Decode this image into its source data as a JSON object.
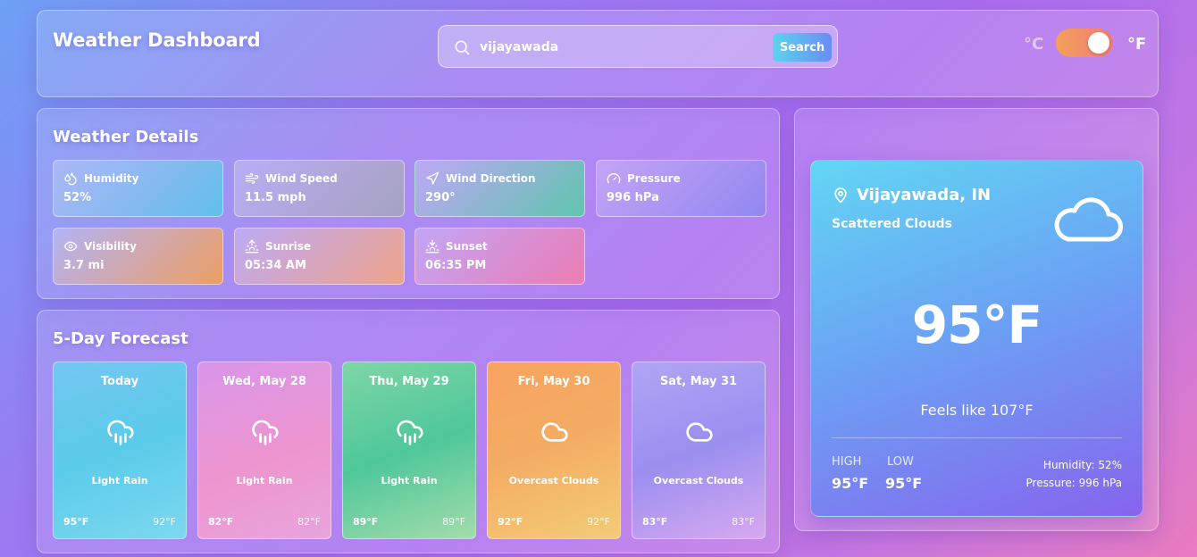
{
  "header": {
    "title": "Weather Dashboard",
    "search": {
      "value": "vijayawada",
      "button_label": "Search"
    },
    "units": {
      "celsius_label": "°C",
      "fahrenheit_label": "°F",
      "selected": "F"
    }
  },
  "details": {
    "title": "Weather Details",
    "items": [
      {
        "label": "Humidity",
        "value": "52%",
        "icon": "droplets-icon",
        "color": "#55c7e8"
      },
      {
        "label": "Wind Speed",
        "value": "11.5 mph",
        "icon": "wind-icon",
        "color": "#a3a7b7"
      },
      {
        "label": "Wind Direction",
        "value": "290°",
        "icon": "navigation-icon",
        "color": "#52cfa3"
      },
      {
        "label": "Pressure",
        "value": "996 hPa",
        "icon": "gauge-icon",
        "color": "#8c88f0"
      },
      {
        "label": "Visibility",
        "value": "3.7 mi",
        "icon": "eye-icon",
        "color": "#f5a24c"
      },
      {
        "label": "Sunrise",
        "value": "05:34 AM",
        "icon": "sunrise-icon",
        "color": "#f7a87a"
      },
      {
        "label": "Sunset",
        "value": "06:35 PM",
        "icon": "sunset-icon",
        "color": "#f47ba9"
      }
    ]
  },
  "forecast": {
    "title": "5-Day Forecast",
    "days": [
      {
        "date": "Today",
        "desc": "Light Rain",
        "high": "95°F",
        "low": "92°F",
        "icon": "cloud-rain-icon"
      },
      {
        "date": "Wed, May 28",
        "desc": "Light Rain",
        "high": "82°F",
        "low": "82°F",
        "icon": "cloud-rain-icon"
      },
      {
        "date": "Thu, May 29",
        "desc": "Light Rain",
        "high": "89°F",
        "low": "89°F",
        "icon": "cloud-rain-icon"
      },
      {
        "date": "Fri, May 30",
        "desc": "Overcast Clouds",
        "high": "92°F",
        "low": "92°F",
        "icon": "cloud-icon"
      },
      {
        "date": "Sat, May 31",
        "desc": "Overcast Clouds",
        "high": "83°F",
        "low": "83°F",
        "icon": "cloud-icon"
      }
    ]
  },
  "current": {
    "city": "Vijayawada, IN",
    "description": "Scattered Clouds",
    "temp": "95°F",
    "feels_like": "Feels like 107°F",
    "high_label": "HIGH",
    "low_label": "LOW",
    "high": "95°F",
    "low": "95°F",
    "humidity": "Humidity: 52%",
    "pressure": "Pressure: 996 hPa"
  }
}
